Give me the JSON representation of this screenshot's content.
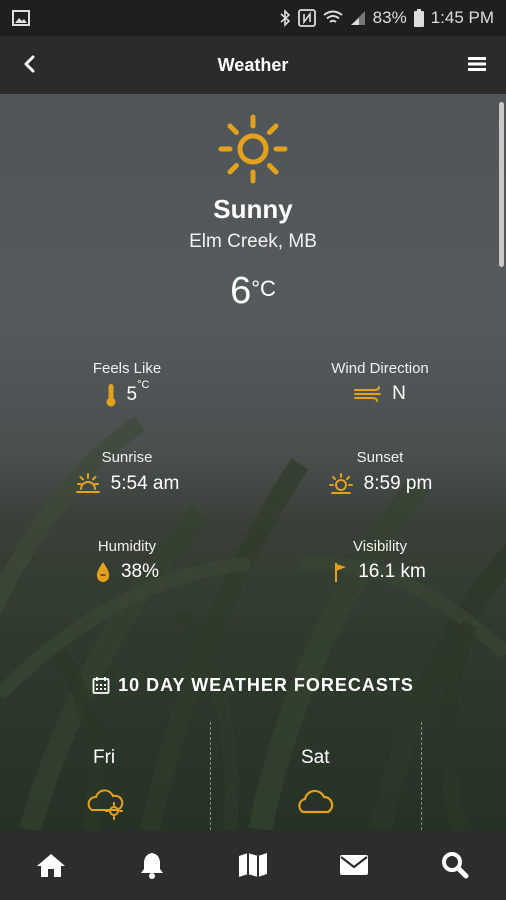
{
  "status_bar": {
    "battery_percent": "83%",
    "time": "1:45 PM",
    "icons": [
      "image-icon",
      "bluetooth-icon",
      "nfc-icon",
      "wifi-icon",
      "signal-icon",
      "battery-icon"
    ]
  },
  "app_bar": {
    "title": "Weather"
  },
  "current": {
    "condition": "Sunny",
    "location": "Elm Creek, MB",
    "temperature": "6",
    "temperature_unit": "°C"
  },
  "stats": {
    "feels_like": {
      "label": "Feels Like",
      "value": "5",
      "unit": "°C"
    },
    "wind_direction": {
      "label": "Wind Direction",
      "value": "N"
    },
    "sunrise": {
      "label": "Sunrise",
      "value": "5:54 am"
    },
    "sunset": {
      "label": "Sunset",
      "value": "8:59 pm"
    },
    "humidity": {
      "label": "Humidity",
      "value": "38%"
    },
    "visibility": {
      "label": "Visibility",
      "value": "16.1 km"
    }
  },
  "forecast": {
    "heading": "10 DAY WEATHER FORECASTS",
    "days": [
      {
        "name": "Fri",
        "icon": "partly-cloudy-icon"
      },
      {
        "name": "Sat",
        "icon": "cloudy-icon"
      }
    ]
  },
  "colors": {
    "accent": "#e4a11b",
    "app_bar": "#2b2b2b",
    "nav": "#2d2d2d"
  },
  "bottom_nav": [
    "home-icon",
    "bell-icon",
    "map-icon",
    "mail-icon",
    "search-icon"
  ]
}
